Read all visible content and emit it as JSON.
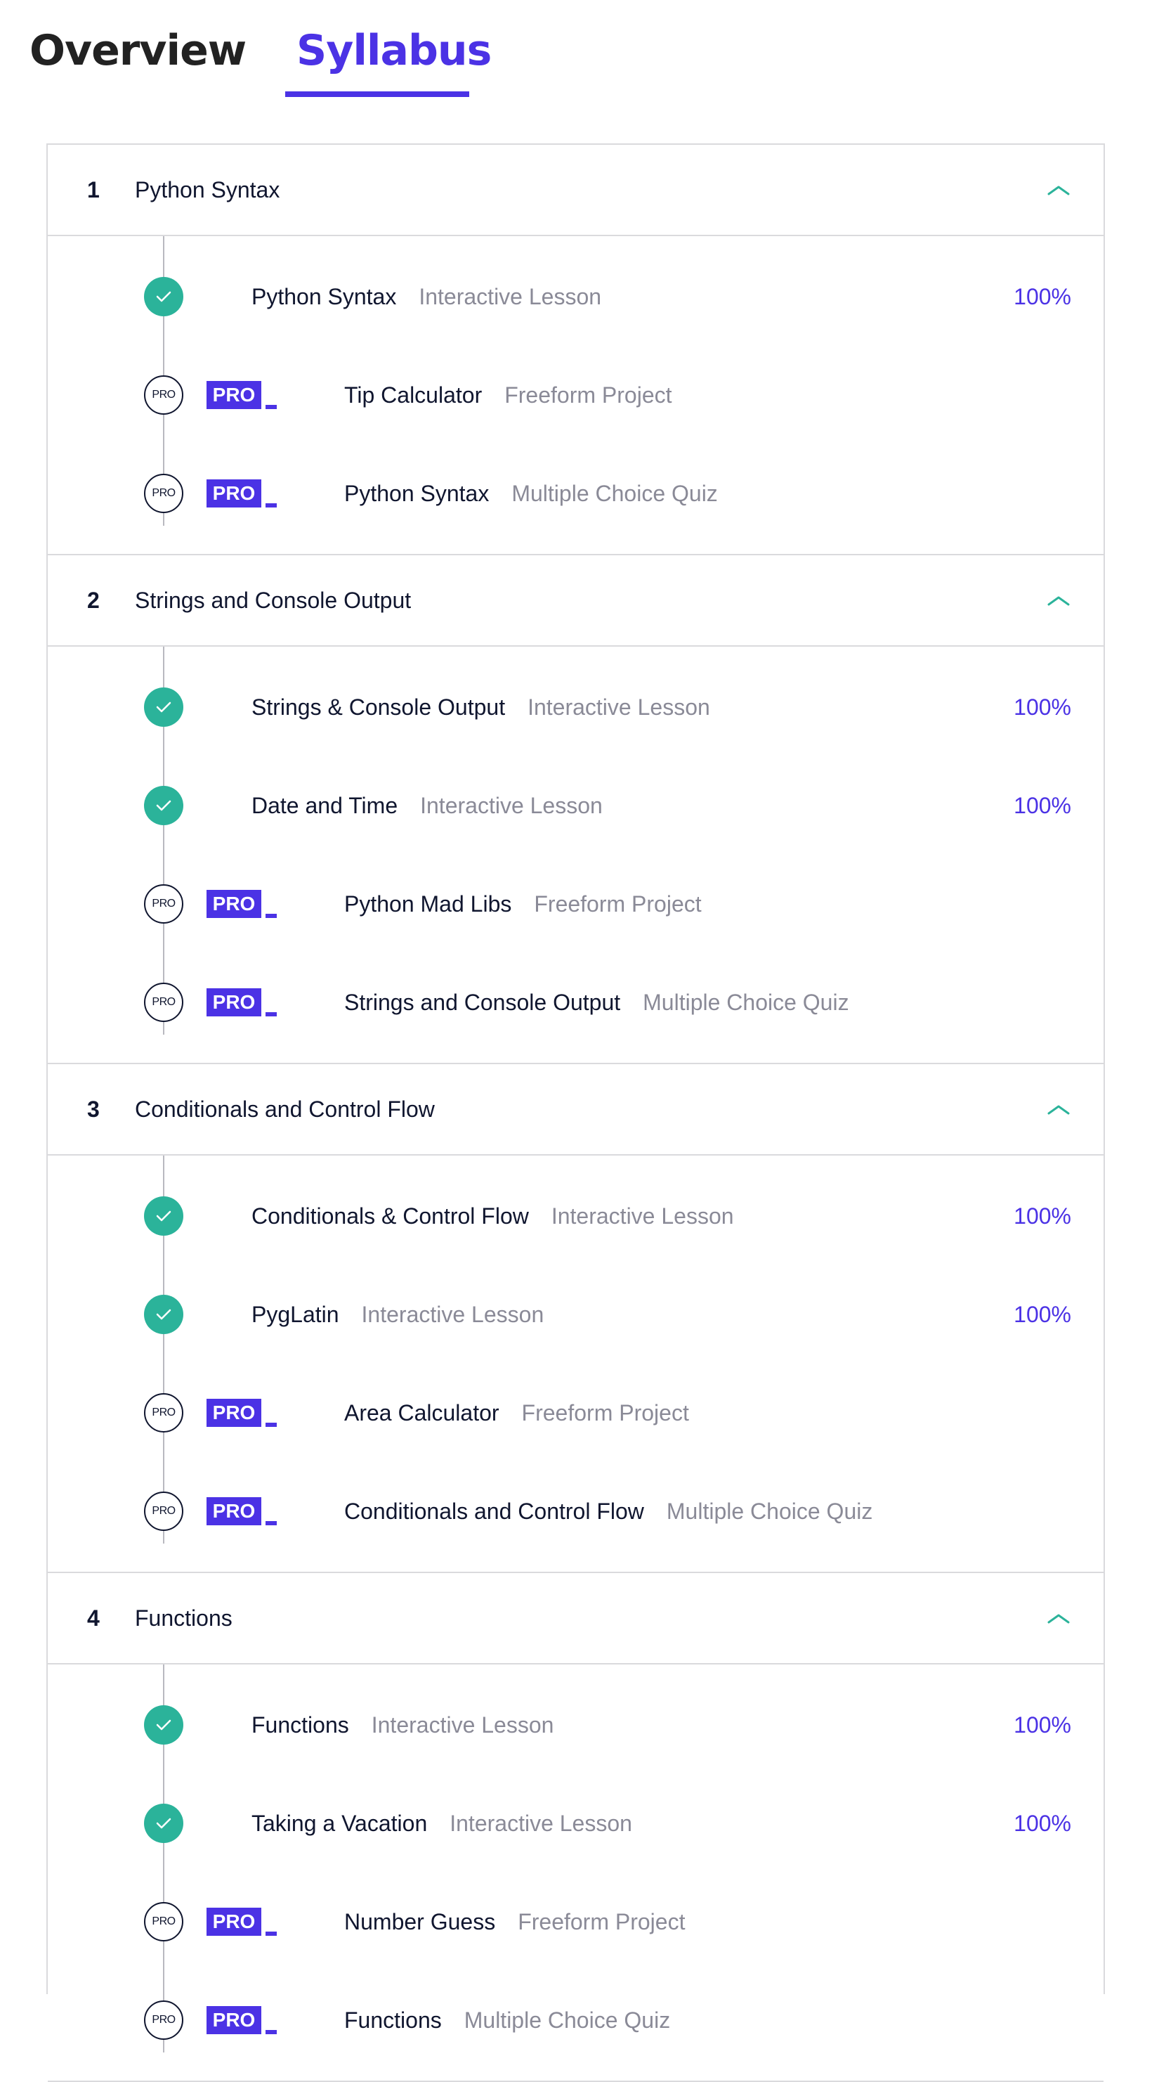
{
  "tabs": {
    "overview": "Overview",
    "syllabus": "Syllabus"
  },
  "colors": {
    "accent": "#4b32e5",
    "success": "#2bb39a",
    "text": "#10162f",
    "muted": "#8a8a97",
    "border": "#dadadd"
  },
  "badge_label": "PRO",
  "modules": [
    {
      "number": "1",
      "title": "Python Syntax",
      "items": [
        {
          "title": "Python Syntax",
          "type": "Interactive Lesson",
          "status": "done",
          "progress": "100%"
        },
        {
          "title": "Tip Calculator",
          "type": "Freeform Project",
          "status": "pro",
          "progress": ""
        },
        {
          "title": "Python Syntax",
          "type": "Multiple Choice Quiz",
          "status": "pro",
          "progress": ""
        }
      ]
    },
    {
      "number": "2",
      "title": "Strings and Console Output",
      "items": [
        {
          "title": "Strings & Console Output",
          "type": "Interactive Lesson",
          "status": "done",
          "progress": "100%"
        },
        {
          "title": "Date and Time",
          "type": "Interactive Lesson",
          "status": "done",
          "progress": "100%"
        },
        {
          "title": "Python Mad Libs",
          "type": "Freeform Project",
          "status": "pro",
          "progress": ""
        },
        {
          "title": "Strings and Console Output",
          "type": "Multiple Choice Quiz",
          "status": "pro",
          "progress": ""
        }
      ]
    },
    {
      "number": "3",
      "title": "Conditionals and Control Flow",
      "items": [
        {
          "title": "Conditionals & Control Flow",
          "type": "Interactive Lesson",
          "status": "done",
          "progress": "100%"
        },
        {
          "title": "PygLatin",
          "type": "Interactive Lesson",
          "status": "done",
          "progress": "100%"
        },
        {
          "title": "Area Calculator",
          "type": "Freeform Project",
          "status": "pro",
          "progress": ""
        },
        {
          "title": "Conditionals and Control Flow",
          "type": "Multiple Choice Quiz",
          "status": "pro",
          "progress": ""
        }
      ]
    },
    {
      "number": "4",
      "title": "Functions",
      "items": [
        {
          "title": "Functions",
          "type": "Interactive Lesson",
          "status": "done",
          "progress": "100%"
        },
        {
          "title": "Taking a Vacation",
          "type": "Interactive Lesson",
          "status": "done",
          "progress": "100%"
        },
        {
          "title": "Number Guess",
          "type": "Freeform Project",
          "status": "pro",
          "progress": ""
        },
        {
          "title": "Functions",
          "type": "Multiple Choice Quiz",
          "status": "pro",
          "progress": ""
        }
      ]
    }
  ]
}
